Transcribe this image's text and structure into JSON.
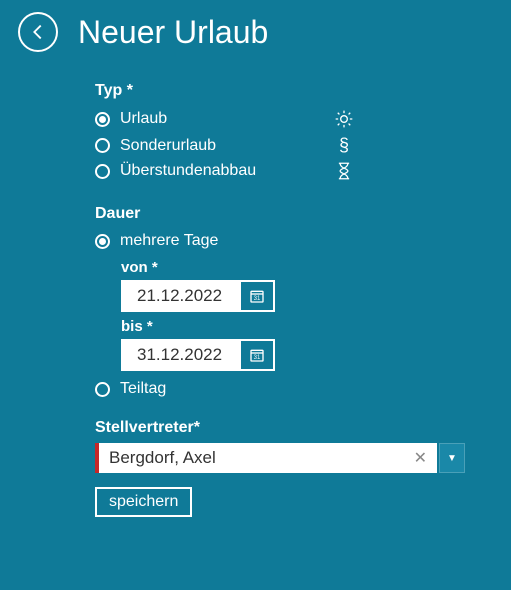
{
  "header": {
    "title": "Neuer Urlaub"
  },
  "type_section": {
    "label": "Typ *",
    "options": [
      {
        "label": "Urlaub",
        "icon": "sun-icon",
        "checked": true
      },
      {
        "label": "Sonderurlaub",
        "icon": "paragraph-icon",
        "checked": false
      },
      {
        "label": "Überstundenabbau",
        "icon": "hourglass-icon",
        "checked": false
      }
    ]
  },
  "duration_section": {
    "label": "Dauer",
    "multi_label": "mehrere Tage",
    "multi_checked": true,
    "from_label": "von *",
    "from_value": "21.12.2022",
    "to_label": "bis *",
    "to_value": "31.12.2022",
    "partial_label": "Teiltag",
    "partial_checked": false
  },
  "substitute": {
    "label": "Stellvertreter*",
    "value": "Bergdorf, Axel"
  },
  "actions": {
    "save": "speichern"
  }
}
